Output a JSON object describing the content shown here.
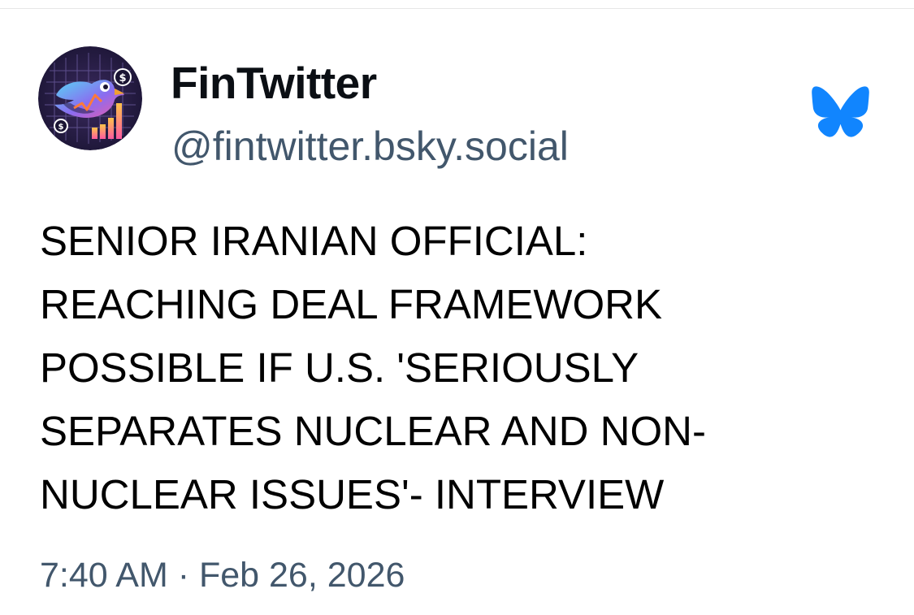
{
  "post": {
    "author": {
      "display_name": "FinTwitter",
      "handle": "@fintwitter.bsky.social",
      "avatar_icon": "bird-chart-avatar-icon"
    },
    "platform_icon": "bluesky-butterfly-icon",
    "text_lines": [
      "SENIOR IRANIAN OFFICIAL:",
      "REACHING DEAL FRAMEWORK",
      "POSSIBLE IF U.S. 'SERIOUSLY",
      "SEPARATES NUCLEAR AND NON-",
      "NUCLEAR ISSUES'- INTERVIEW"
    ],
    "timestamp": "7:40 AM · Feb 26, 2026"
  },
  "colors": {
    "text": "#000000",
    "secondary_text": "#42576c",
    "bluesky_blue": "#1185fe",
    "background": "#ffffff"
  }
}
